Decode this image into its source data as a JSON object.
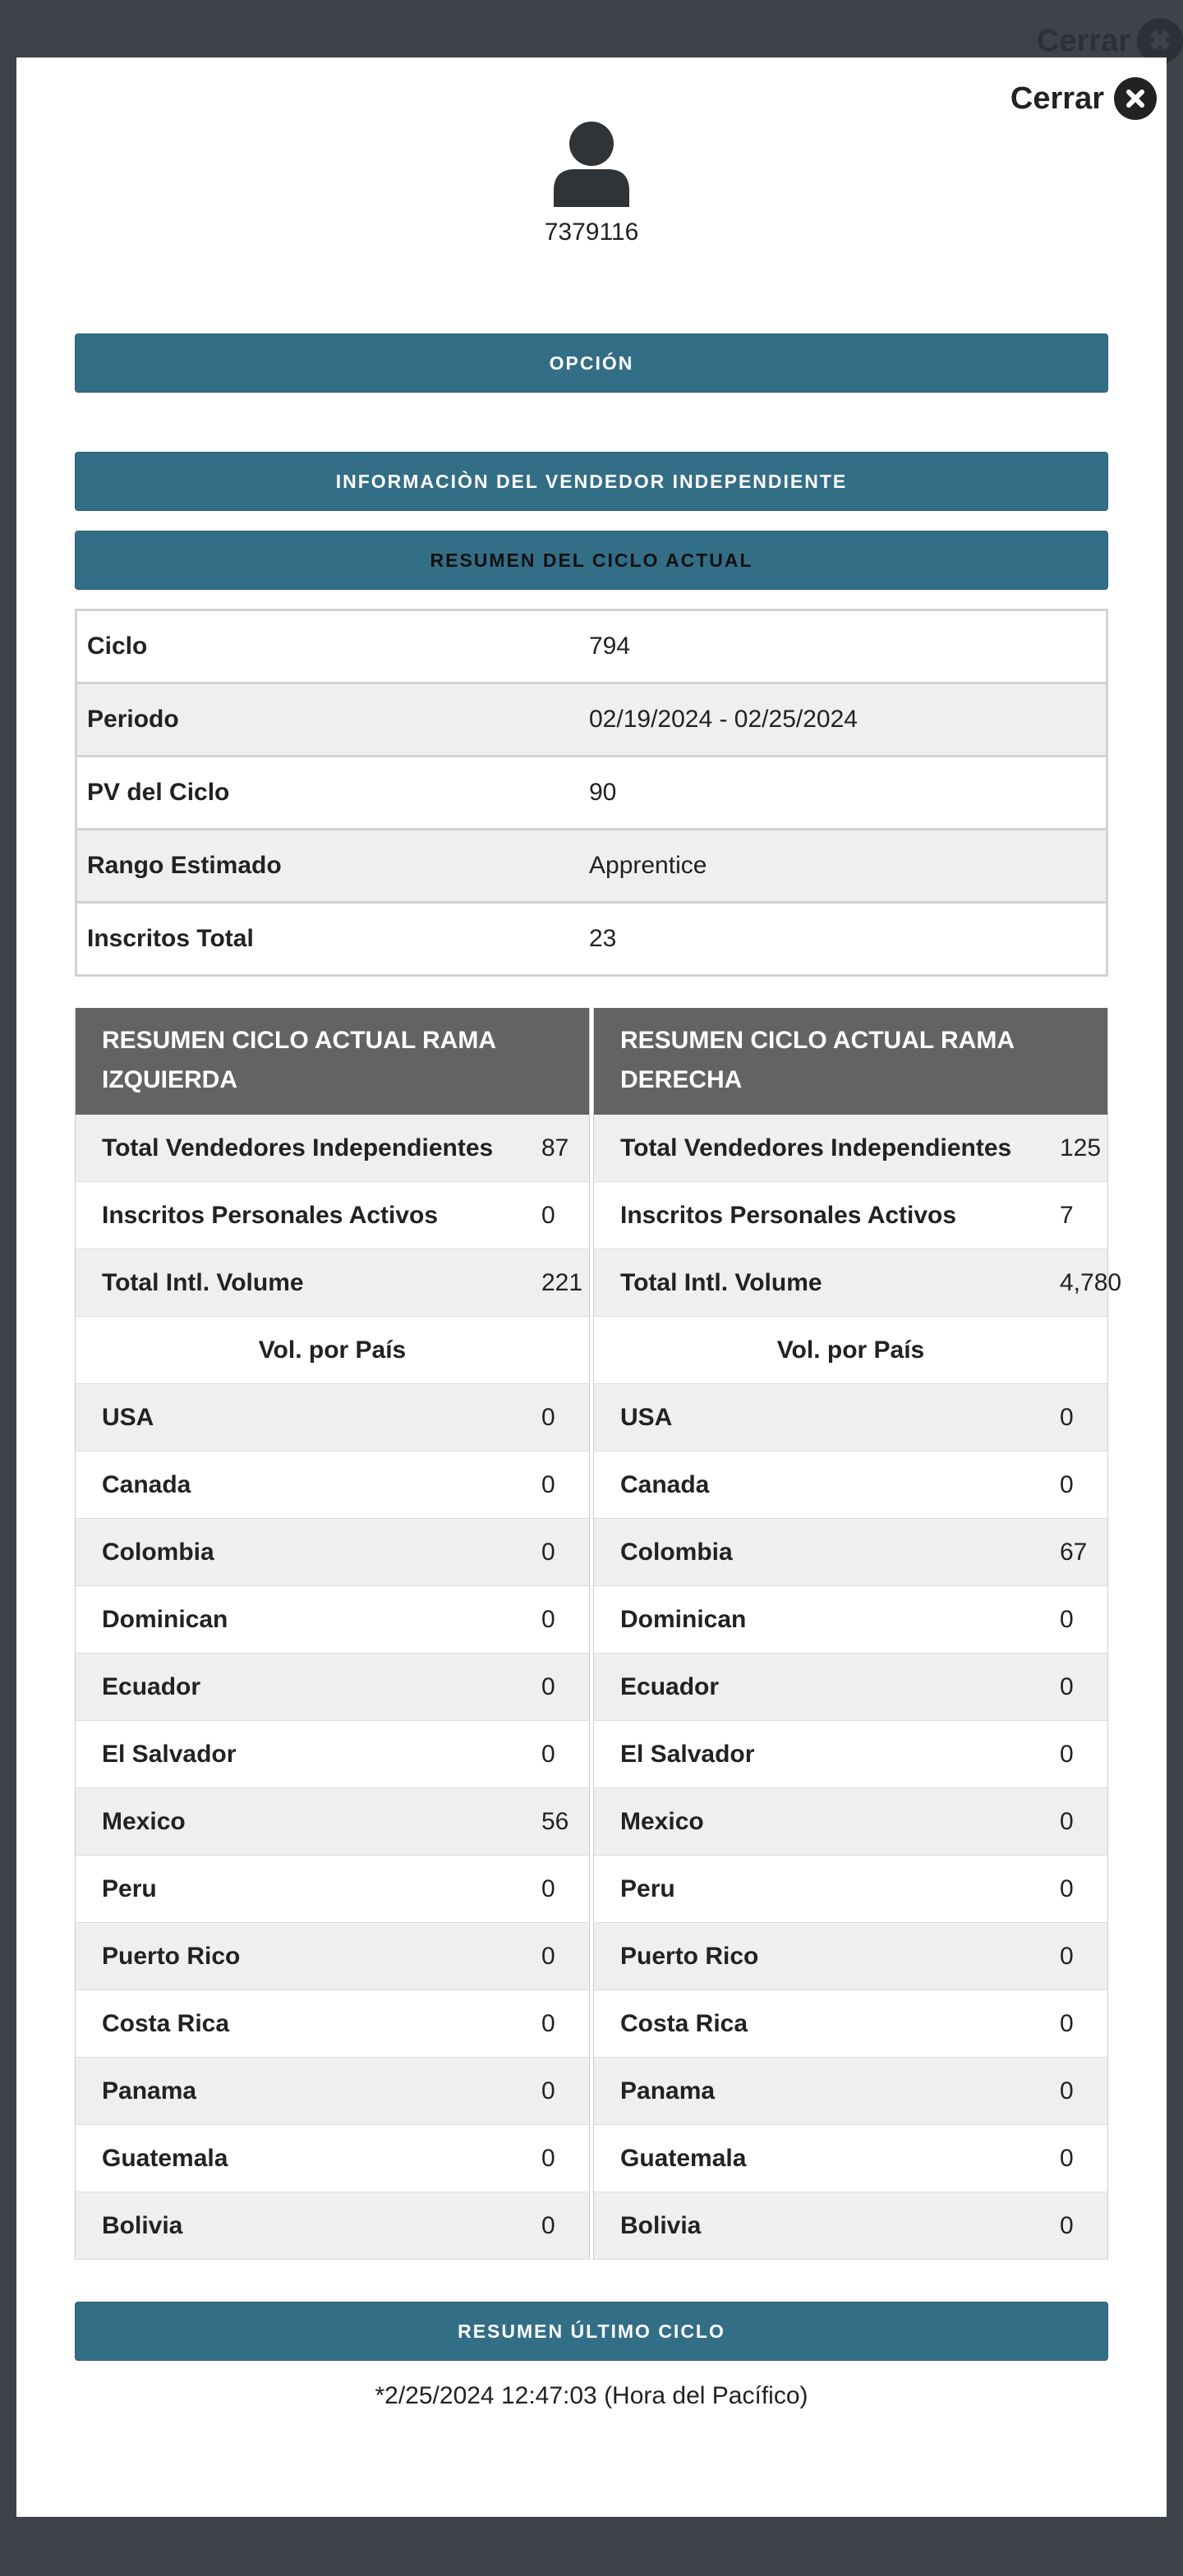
{
  "background": {
    "close_label": "Cerrar"
  },
  "modal": {
    "close_label": "Cerrar",
    "user_id": "7379116",
    "option_label": "OPCIÓN",
    "info_label": "INFORMACIÒN DEL VENDEDOR INDEPENDIENTE",
    "current_cycle_label": "RESUMEN DEL CICLO ACTUAL",
    "summary": [
      {
        "key": "Ciclo",
        "value": "794"
      },
      {
        "key": "Periodo",
        "value": "02/19/2024 - 02/25/2024"
      },
      {
        "key": "PV del Ciclo",
        "value": "90"
      },
      {
        "key": "Rango Estimado",
        "value": "Apprentice"
      },
      {
        "key": "Inscritos Total",
        "value": "23"
      }
    ],
    "left_branch": {
      "title": "RESUMEN CICLO ACTUAL RAMA IZQUIERDA",
      "total_label": "Total Vendedores Independientes",
      "total_value": "87",
      "active_label": "Inscritos Personales Activos",
      "active_value": "0",
      "volume_label": "Total Intl. Volume",
      "volume_value": "221",
      "by_country_label": "Vol. por País",
      "countries": [
        {
          "name": "USA",
          "value": "0"
        },
        {
          "name": "Canada",
          "value": "0"
        },
        {
          "name": "Colombia",
          "value": "0"
        },
        {
          "name": "Dominican",
          "value": "0"
        },
        {
          "name": "Ecuador",
          "value": "0"
        },
        {
          "name": "El Salvador",
          "value": "0"
        },
        {
          "name": "Mexico",
          "value": "56"
        },
        {
          "name": "Peru",
          "value": "0"
        },
        {
          "name": "Puerto Rico",
          "value": "0"
        },
        {
          "name": "Costa Rica",
          "value": "0"
        },
        {
          "name": "Panama",
          "value": "0"
        },
        {
          "name": "Guatemala",
          "value": "0"
        },
        {
          "name": "Bolivia",
          "value": "0"
        }
      ]
    },
    "right_branch": {
      "title": "RESUMEN CICLO ACTUAL RAMA DERECHA",
      "total_label": "Total Vendedores Independientes",
      "total_value": "125",
      "active_label": "Inscritos Personales Activos",
      "active_value": "7",
      "volume_label": "Total Intl. Volume",
      "volume_value": "4,780",
      "by_country_label": "Vol. por País",
      "countries": [
        {
          "name": "USA",
          "value": "0"
        },
        {
          "name": "Canada",
          "value": "0"
        },
        {
          "name": "Colombia",
          "value": "67"
        },
        {
          "name": "Dominican",
          "value": "0"
        },
        {
          "name": "Ecuador",
          "value": "0"
        },
        {
          "name": "El Salvador",
          "value": "0"
        },
        {
          "name": "Mexico",
          "value": "0"
        },
        {
          "name": "Peru",
          "value": "0"
        },
        {
          "name": "Puerto Rico",
          "value": "0"
        },
        {
          "name": "Costa Rica",
          "value": "0"
        },
        {
          "name": "Panama",
          "value": "0"
        },
        {
          "name": "Guatemala",
          "value": "0"
        },
        {
          "name": "Bolivia",
          "value": "0"
        }
      ]
    },
    "last_cycle_label": "RESUMEN ÚLTIMO CICLO",
    "timestamp": "*2/25/2024 12:47:03 (Hora del Pacífico)"
  }
}
